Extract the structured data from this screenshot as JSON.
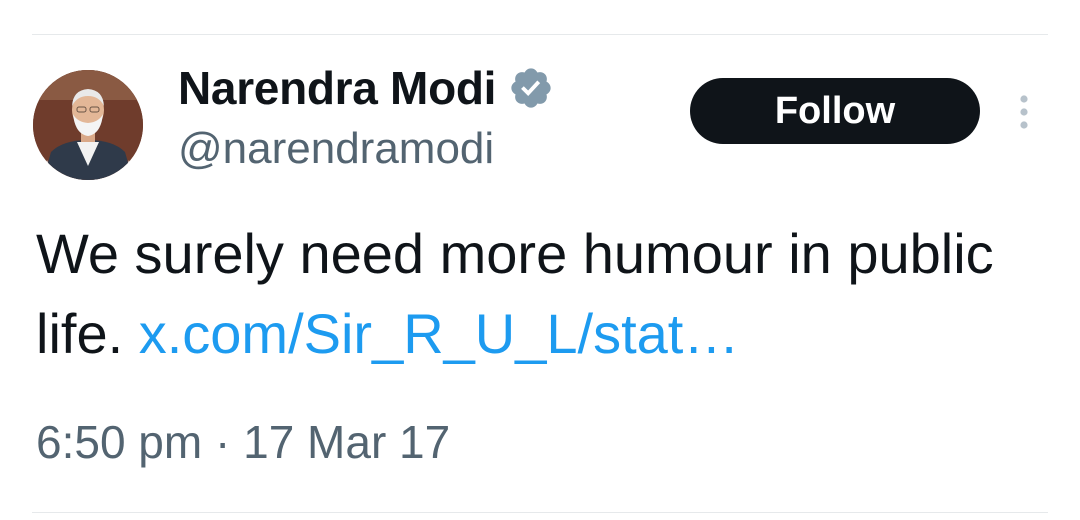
{
  "author": {
    "display_name": "Narendra Modi",
    "handle": "@narendramodi",
    "verified": true,
    "verified_color": "#829aab"
  },
  "actions": {
    "follow_label": "Follow"
  },
  "tweet": {
    "text_line": "We surely need more humour in public life.",
    "link_text": "x.com/Sir_R_U_L/stat…",
    "link_color": "#1d9bf0"
  },
  "meta": {
    "time": "6:50 pm",
    "separator": "·",
    "date": "17 Mar 17"
  },
  "icons": {
    "verified": "verified-badge-icon",
    "more": "more-vertical-icon"
  }
}
